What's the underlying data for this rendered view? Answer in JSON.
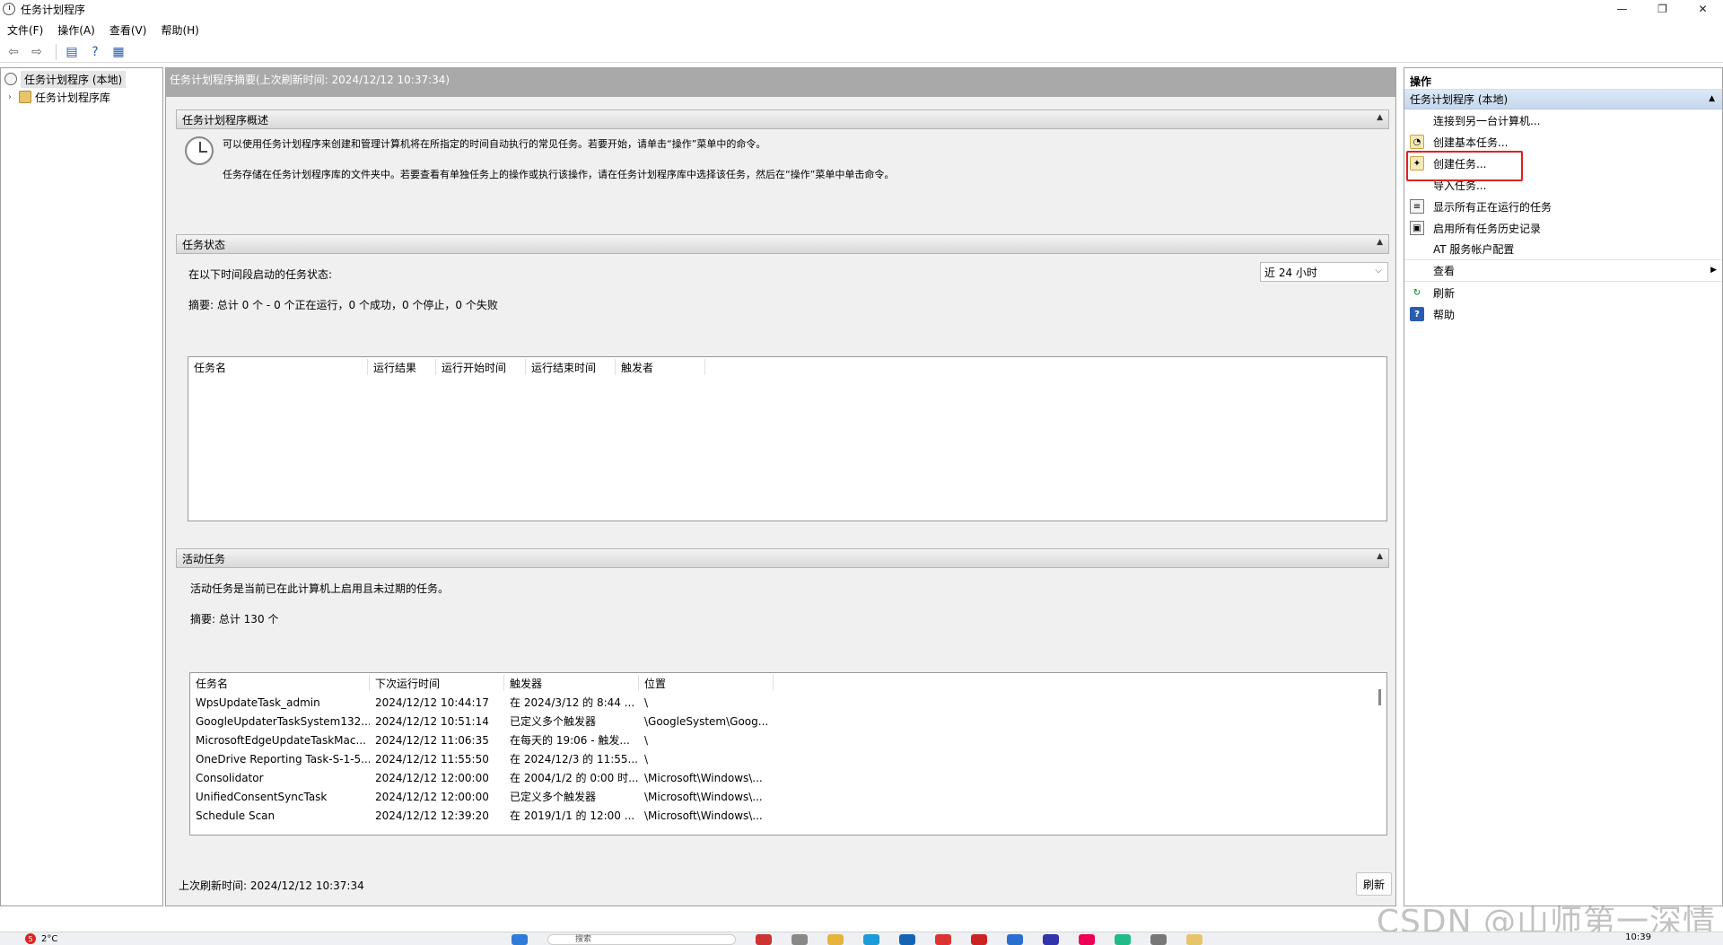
{
  "window": {
    "title": "任务计划程序",
    "controls": {
      "minimize": "—",
      "maximize": "❐",
      "close": "✕"
    }
  },
  "menu": {
    "items": [
      "文件(F)",
      "操作(A)",
      "查看(V)",
      "帮助(H)"
    ]
  },
  "tree": {
    "root": "任务计划程序 (本地)",
    "library": "任务计划程序库"
  },
  "main": {
    "header": "任务计划程序摘要(上次刷新时间: 2024/12/12 10:37:34)",
    "overview": {
      "title": "任务计划程序概述",
      "line1": "可以使用任务计划程序来创建和管理计算机将在所指定的时间自动执行的常见任务。若要开始，请单击“操作”菜单中的命令。",
      "line2": "任务存储在任务计划程序库的文件夹中。若要查看有单独任务上的操作或执行该操作，请在任务计划程序库中选择该任务，然后在“操作”菜单中单击命令。"
    },
    "status": {
      "title": "任务状态",
      "period_label": "在以下时间段启动的任务状态:",
      "period_value": "近 24 小时",
      "summary": "摘要: 总计 0 个 - 0 个正在运行，0 个成功，0 个停止，0 个失败",
      "columns": [
        "任务名",
        "运行结果",
        "运行开始时间",
        "运行结束时间",
        "触发者"
      ]
    },
    "active": {
      "title": "活动任务",
      "description": "活动任务是当前已在此计算机上启用且未过期的任务。",
      "summary": "摘要: 总计 130 个",
      "columns": [
        "任务名",
        "下次运行时间",
        "触发器",
        "位置"
      ],
      "rows": [
        [
          "WpsUpdateTask_admin",
          "2024/12/12 10:44:17",
          "在 2024/3/12 的 8:44 ...",
          "\\"
        ],
        [
          "GoogleUpdaterTaskSystem132....",
          "2024/12/12 10:51:14",
          "已定义多个触发器",
          "\\GoogleSystem\\Goog..."
        ],
        [
          "MicrosoftEdgeUpdateTaskMac...",
          "2024/12/12 11:06:35",
          "在每天的 19:06 - 触发...",
          "\\"
        ],
        [
          "OneDrive Reporting Task-S-1-5...",
          "2024/12/12 11:55:50",
          "在 2024/12/3 的 11:55...",
          "\\"
        ],
        [
          "Consolidator",
          "2024/12/12 12:00:00",
          "在 2004/1/2 的 0:00 时...",
          "\\Microsoft\\Windows\\..."
        ],
        [
          "UnifiedConsentSyncTask",
          "2024/12/12 12:00:00",
          "已定义多个触发器",
          "\\Microsoft\\Windows\\..."
        ],
        [
          "Schedule Scan",
          "2024/12/12 12:39:20",
          "在 2019/1/1 的 12:00 ...",
          "\\Microsoft\\Windows\\..."
        ]
      ]
    },
    "footer": {
      "last_refresh": "上次刷新时间: 2024/12/12 10:37:34",
      "refresh_button": "刷新"
    }
  },
  "actions": {
    "title": "操作",
    "group": "任务计划程序 (本地)",
    "items": [
      {
        "label": "连接到另一台计算机...",
        "icon": "none"
      },
      {
        "label": "创建基本任务...",
        "icon": "wizard-icon"
      },
      {
        "label": "创建任务...",
        "icon": "create-task-icon"
      },
      {
        "label": "导入任务...",
        "icon": "none"
      },
      {
        "label": "显示所有正在运行的任务",
        "icon": "list-icon"
      },
      {
        "label": "启用所有任务历史记录",
        "icon": "history-icon"
      },
      {
        "label": "AT 服务帐户配置",
        "icon": "none"
      },
      {
        "label": "查看",
        "icon": "none"
      },
      {
        "label": "刷新",
        "icon": "refresh-icon"
      },
      {
        "label": "帮助",
        "icon": "help-icon"
      }
    ]
  },
  "taskbar": {
    "notification_count": "5",
    "weather": "2°C",
    "search_placeholder": "搜索",
    "time": "10:39"
  },
  "watermark": "CSDN @山师第一深情",
  "colors": {
    "highlight": "#e02020",
    "section_header_bg": "#a9a9a9",
    "actions_group_bg": "#c6d8ee"
  }
}
